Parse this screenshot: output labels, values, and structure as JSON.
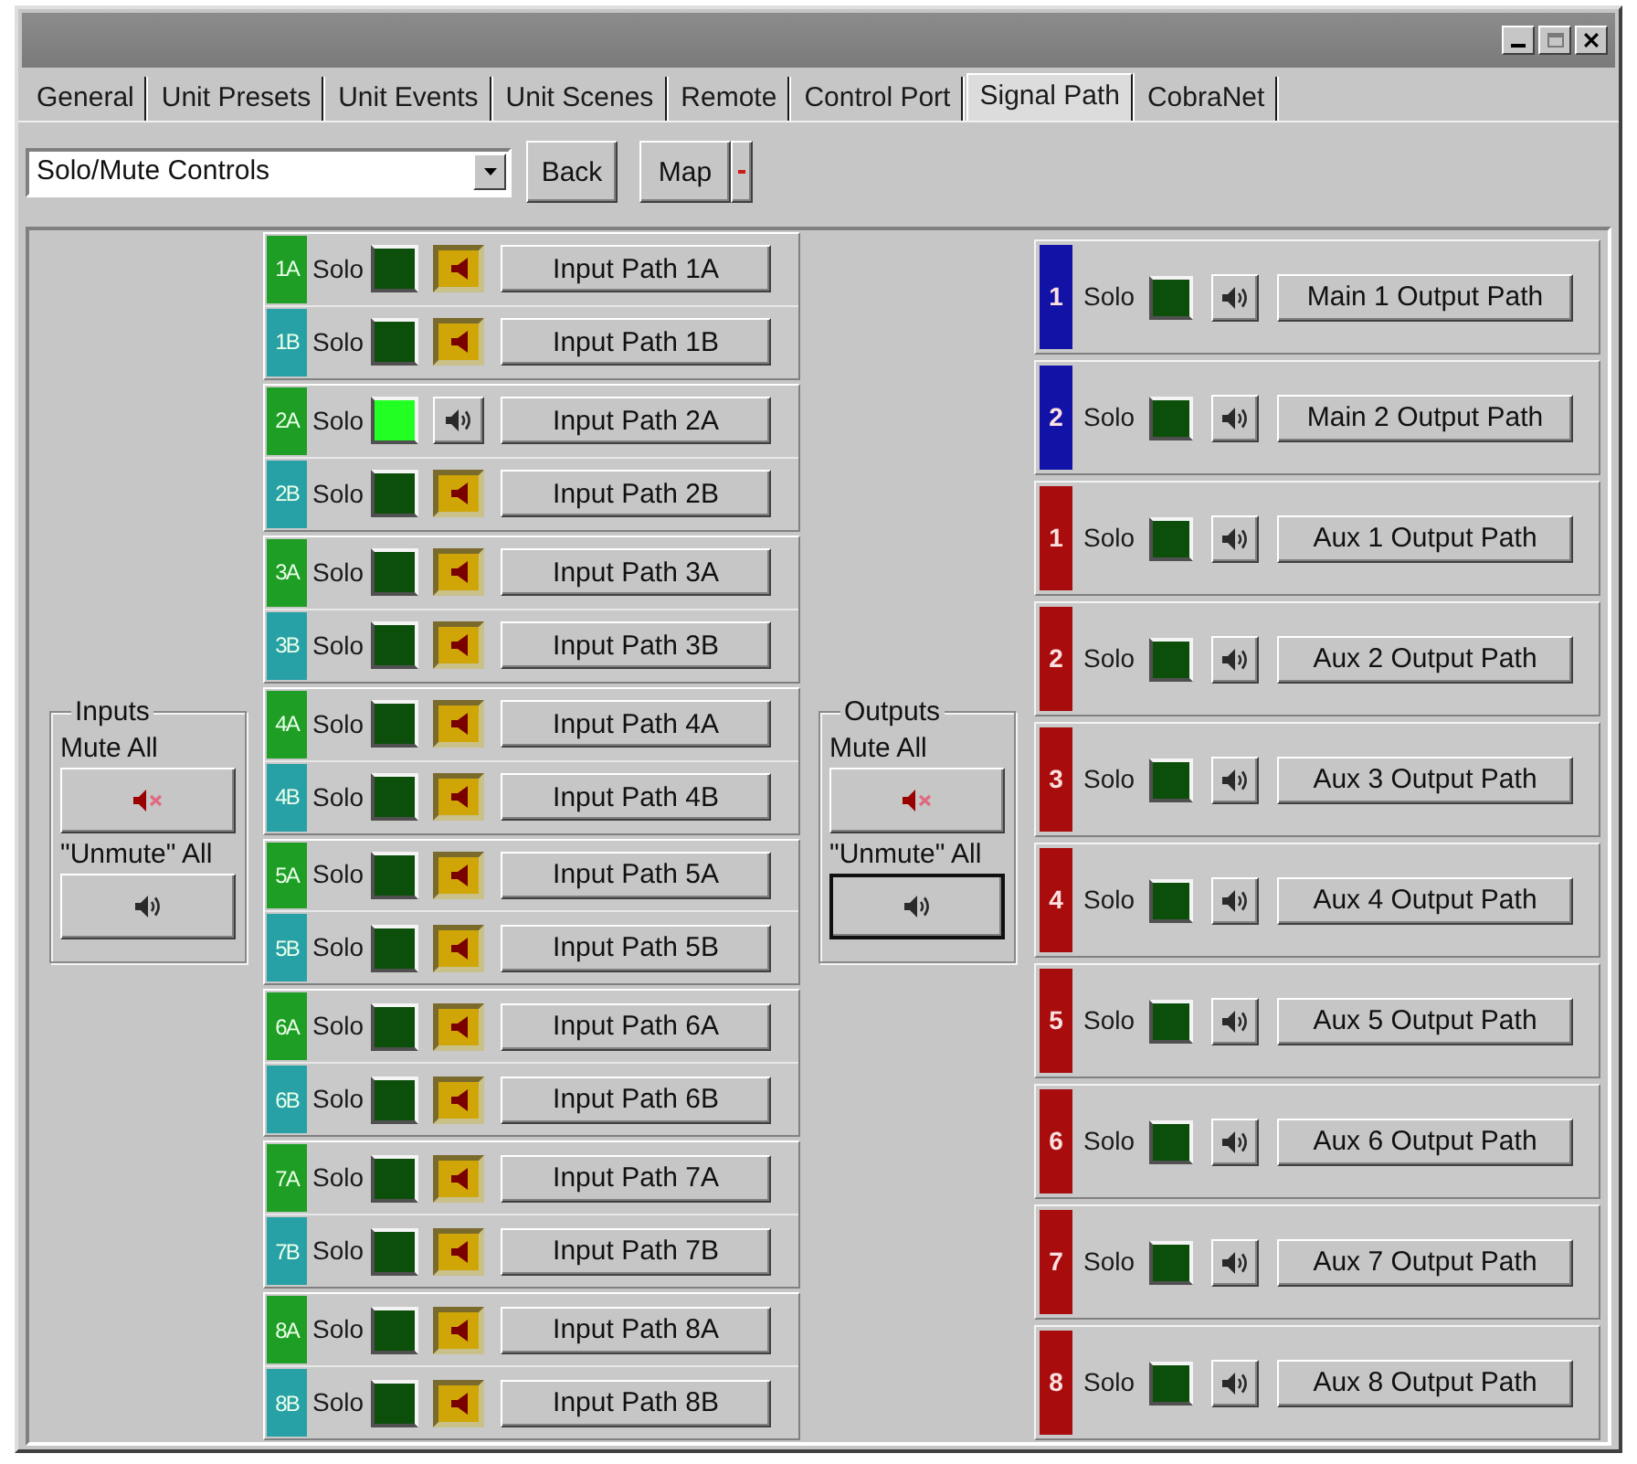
{
  "tabs": [
    {
      "label": "General",
      "selected": false
    },
    {
      "label": "Unit Presets",
      "selected": false
    },
    {
      "label": "Unit Events",
      "selected": false
    },
    {
      "label": "Unit Scenes",
      "selected": false
    },
    {
      "label": "Remote",
      "selected": false
    },
    {
      "label": "Control Port",
      "selected": false
    },
    {
      "label": "Signal Path",
      "selected": true
    },
    {
      "label": "CobraNet",
      "selected": false
    }
  ],
  "toolbar": {
    "view_dropdown": {
      "value": "Solo/Mute Controls"
    },
    "buttons": [
      "Back",
      "Map"
    ]
  },
  "inputs_group": {
    "title": "Inputs",
    "mute_all_label": "Mute All",
    "unmute_all_label": "\"Unmute\" All",
    "unmute_all_focused": false
  },
  "input_channel_pairs": [
    {
      "channels": [
        {
          "label": "1A",
          "color": "#1e9e24",
          "solo_label": "Solo",
          "solo": false,
          "muted": true,
          "path_button": "Input Path 1A"
        },
        {
          "label": "1B",
          "color": "#27a0a6",
          "solo_label": "Solo",
          "solo": false,
          "muted": true,
          "path_button": "Input Path 1B"
        }
      ]
    },
    {
      "channels": [
        {
          "label": "2A",
          "color": "#1e9e24",
          "solo_label": "Solo",
          "solo": true,
          "muted": false,
          "path_button": "Input Path 2A"
        },
        {
          "label": "2B",
          "color": "#27a0a6",
          "solo_label": "Solo",
          "solo": false,
          "muted": true,
          "path_button": "Input Path 2B"
        }
      ]
    },
    {
      "channels": [
        {
          "label": "3A",
          "color": "#1e9e24",
          "solo_label": "Solo",
          "solo": false,
          "muted": true,
          "path_button": "Input Path 3A"
        },
        {
          "label": "3B",
          "color": "#27a0a6",
          "solo_label": "Solo",
          "solo": false,
          "muted": true,
          "path_button": "Input Path 3B"
        }
      ]
    },
    {
      "channels": [
        {
          "label": "4A",
          "color": "#1e9e24",
          "solo_label": "Solo",
          "solo": false,
          "muted": true,
          "path_button": "Input Path 4A"
        },
        {
          "label": "4B",
          "color": "#27a0a6",
          "solo_label": "Solo",
          "solo": false,
          "muted": true,
          "path_button": "Input Path 4B"
        }
      ]
    },
    {
      "channels": [
        {
          "label": "5A",
          "color": "#1e9e24",
          "solo_label": "Solo",
          "solo": false,
          "muted": true,
          "path_button": "Input Path 5A"
        },
        {
          "label": "5B",
          "color": "#27a0a6",
          "solo_label": "Solo",
          "solo": false,
          "muted": true,
          "path_button": "Input Path 5B"
        }
      ]
    },
    {
      "channels": [
        {
          "label": "6A",
          "color": "#1e9e24",
          "solo_label": "Solo",
          "solo": false,
          "muted": true,
          "path_button": "Input Path 6A"
        },
        {
          "label": "6B",
          "color": "#27a0a6",
          "solo_label": "Solo",
          "solo": false,
          "muted": true,
          "path_button": "Input Path 6B"
        }
      ]
    },
    {
      "channels": [
        {
          "label": "7A",
          "color": "#1e9e24",
          "solo_label": "Solo",
          "solo": false,
          "muted": true,
          "path_button": "Input Path 7A"
        },
        {
          "label": "7B",
          "color": "#27a0a6",
          "solo_label": "Solo",
          "solo": false,
          "muted": true,
          "path_button": "Input Path 7B"
        }
      ]
    },
    {
      "channels": [
        {
          "label": "8A",
          "color": "#1e9e24",
          "solo_label": "Solo",
          "solo": false,
          "muted": true,
          "path_button": "Input Path 8A"
        },
        {
          "label": "8B",
          "color": "#27a0a6",
          "solo_label": "Solo",
          "solo": false,
          "muted": true,
          "path_button": "Input Path 8B"
        }
      ]
    }
  ],
  "outputs_group": {
    "title": "Outputs",
    "mute_all_label": "Mute All",
    "unmute_all_label": "\"Unmute\" All",
    "unmute_all_focused": true
  },
  "output_channels": [
    {
      "label": "1",
      "color": "#1212a6",
      "solo_label": "Solo",
      "solo": false,
      "muted": false,
      "path_button": "Main 1 Output Path"
    },
    {
      "label": "2",
      "color": "#1212a6",
      "solo_label": "Solo",
      "solo": false,
      "muted": false,
      "path_button": "Main 2 Output Path"
    },
    {
      "label": "1",
      "color": "#a80c0c",
      "solo_label": "Solo",
      "solo": false,
      "muted": false,
      "path_button": "Aux 1 Output Path"
    },
    {
      "label": "2",
      "color": "#a80c0c",
      "solo_label": "Solo",
      "solo": false,
      "muted": false,
      "path_button": "Aux 2 Output Path"
    },
    {
      "label": "3",
      "color": "#a80c0c",
      "solo_label": "Solo",
      "solo": false,
      "muted": false,
      "path_button": "Aux 3 Output Path"
    },
    {
      "label": "4",
      "color": "#a80c0c",
      "solo_label": "Solo",
      "solo": false,
      "muted": false,
      "path_button": "Aux 4 Output Path"
    },
    {
      "label": "5",
      "color": "#a80c0c",
      "solo_label": "Solo",
      "solo": false,
      "muted": false,
      "path_button": "Aux 5 Output Path"
    },
    {
      "label": "6",
      "color": "#a80c0c",
      "solo_label": "Solo",
      "solo": false,
      "muted": false,
      "path_button": "Aux 6 Output Path"
    },
    {
      "label": "7",
      "color": "#a80c0c",
      "solo_label": "Solo",
      "solo": false,
      "muted": false,
      "path_button": "Aux 7 Output Path"
    },
    {
      "label": "8",
      "color": "#a80c0c",
      "solo_label": "Solo",
      "solo": false,
      "muted": false,
      "path_button": "Aux 8 Output Path"
    }
  ]
}
